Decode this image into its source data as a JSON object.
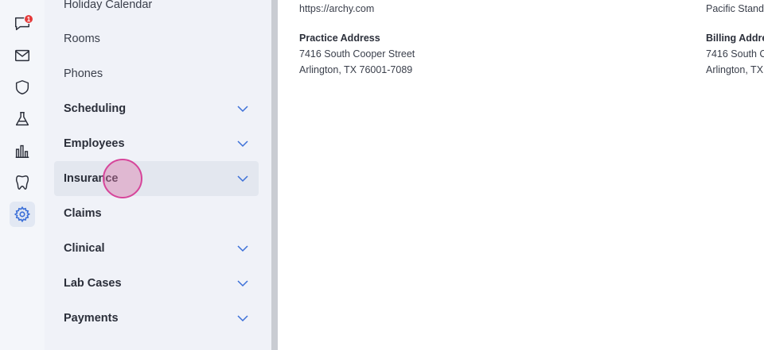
{
  "rail": {
    "message_badge": "1",
    "icons": [
      "chat-icon",
      "mail-icon",
      "shield-icon",
      "flask-icon",
      "bar-chart-icon",
      "tooth-icon",
      "gear-icon"
    ]
  },
  "nav": {
    "items": [
      {
        "label": "Holiday Calendar",
        "section": false,
        "expandable": false
      },
      {
        "label": "Rooms",
        "section": false,
        "expandable": false
      },
      {
        "label": "Phones",
        "section": false,
        "expandable": false
      },
      {
        "label": "Scheduling",
        "section": true,
        "expandable": true
      },
      {
        "label": "Employees",
        "section": true,
        "expandable": true
      },
      {
        "label": "Insurance",
        "section": true,
        "expandable": true
      },
      {
        "label": "Claims",
        "section": true,
        "expandable": false
      },
      {
        "label": "Clinical",
        "section": true,
        "expandable": true
      },
      {
        "label": "Lab Cases",
        "section": true,
        "expandable": true
      },
      {
        "label": "Payments",
        "section": true,
        "expandable": true
      }
    ]
  },
  "content": {
    "website": "https://archy.com",
    "timezone": "Pacific Standa",
    "practice_address": {
      "label": "Practice Address",
      "line1": "7416 South Cooper Street",
      "line2": "Arlington, TX 76001-7089"
    },
    "billing_address": {
      "label": "Billing Addre",
      "line1": "7416 South C",
      "line2": "Arlington, TX"
    }
  },
  "colors": {
    "accent": "#3b6fd8",
    "badge": "#e53a3a",
    "click_indicator": "#d6459a"
  }
}
